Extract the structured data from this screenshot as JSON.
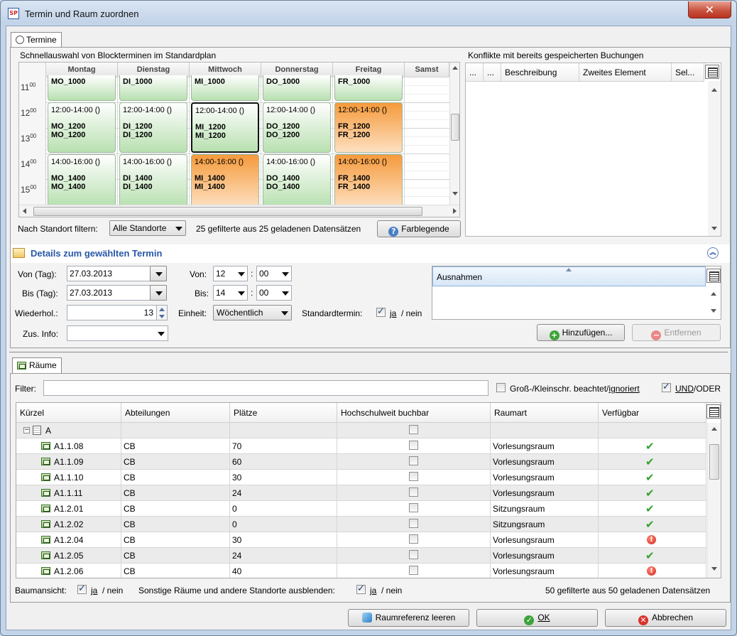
{
  "window": {
    "title": "Termin und Raum zuordnen",
    "close": "✕",
    "app_icon": "SP"
  },
  "termine_tab": {
    "label": "Termine"
  },
  "calendar": {
    "section_title": "Schnellauswahl von Blockterminen im Standardplan",
    "days": [
      "Montag",
      "Dienstag",
      "Mittwoch",
      "Donnerstag",
      "Freitag",
      "Samst"
    ],
    "hours": [
      {
        "h": "11",
        "m": "00"
      },
      {
        "h": "12",
        "m": "00"
      },
      {
        "h": "13",
        "m": "00"
      },
      {
        "h": "14",
        "m": "00"
      },
      {
        "h": "15",
        "m": "00"
      }
    ],
    "row_top": [
      {
        "code": "MO_1000",
        "color": "green"
      },
      {
        "code": "DI_1000",
        "color": "green"
      },
      {
        "code": "MI_1000",
        "color": "green"
      },
      {
        "code": "DO_1000",
        "color": "green"
      },
      {
        "code": "FR_1000",
        "color": "green"
      }
    ],
    "row_mid": [
      {
        "time": "12:00-14:00 ()",
        "code": "MO_1200",
        "color": "green",
        "selected": false
      },
      {
        "time": "12:00-14:00 ()",
        "code": "DI_1200",
        "color": "green",
        "selected": false
      },
      {
        "time": "12:00-14:00 ()",
        "code": "MI_1200",
        "color": "green",
        "selected": true
      },
      {
        "time": "12:00-14:00 ()",
        "code": "DO_1200",
        "color": "green",
        "selected": false
      },
      {
        "time": "12:00-14:00 ()",
        "code": "FR_1200",
        "color": "orange",
        "selected": false
      }
    ],
    "row_bot": [
      {
        "time": "14:00-16:00 ()",
        "code": "MO_1400",
        "color": "green"
      },
      {
        "time": "14:00-16:00 ()",
        "code": "DI_1400",
        "color": "green"
      },
      {
        "time": "14:00-16:00 ()",
        "code": "MI_1400",
        "color": "orange"
      },
      {
        "time": "14:00-16:00 ()",
        "code": "DO_1400",
        "color": "green"
      },
      {
        "time": "14:00-16:00 ()",
        "code": "FR_1400",
        "color": "orange"
      }
    ],
    "filter_label": "Nach Standort filtern:",
    "filter_value": "Alle Standorte",
    "count_text": "25 gefilterte aus 25 geladenen Datensätzen",
    "legend_button": "Farblegende"
  },
  "conflicts": {
    "title": "Konflikte mit bereits gespeicherten Buchungen",
    "columns": [
      "...",
      "...",
      "Beschreibung",
      "Zweites Element",
      "Sel..."
    ]
  },
  "details": {
    "title": "Details zum gewählten Termin",
    "von_tag_label": "Von (Tag):",
    "von_tag_value": "27.03.2013",
    "bis_tag_label": "Bis (Tag):",
    "bis_tag_value": "27.03.2013",
    "wiederhol_label": "Wiederhol.:",
    "wiederhol_value": "13",
    "zus_info_label": "Zus. Info:",
    "zus_info_value": "",
    "von_label": "Von:",
    "von_h": "12",
    "von_m": "00",
    "bis_label": "Bis:",
    "bis_h": "14",
    "bis_m": "00",
    "einheit_label": "Einheit:",
    "einheit_value": "Wöchentlich",
    "standardtermin_label": "Standardtermin:",
    "standardtermin_ja": "ja",
    "standardtermin_sep": "/ nein",
    "ausnahmen_header": "Ausnahmen",
    "add_button": "Hinzufügen...",
    "remove_button": "Entfernen"
  },
  "rooms": {
    "tab_label": "Räume",
    "filter_label": "Filter:",
    "filter_value": "",
    "case_label": "Groß-/Kleinschr. beachtet/",
    "case_ignored": "ignoriert",
    "und_label": "UND",
    "oder_label": "/ODER",
    "columns": [
      "Kürzel",
      "Abteilungen",
      "Plätze",
      "Hochschulweit buchbar",
      "Raumart",
      "Verfügbar"
    ],
    "group": "A",
    "rows": [
      {
        "code": "A1.1.08",
        "dept": "CB",
        "seats": "70",
        "type": "Vorlesungsraum",
        "avail": "ok"
      },
      {
        "code": "A1.1.09",
        "dept": "CB",
        "seats": "60",
        "type": "Vorlesungsraum",
        "avail": "ok"
      },
      {
        "code": "A1.1.10",
        "dept": "CB",
        "seats": "30",
        "type": "Vorlesungsraum",
        "avail": "ok"
      },
      {
        "code": "A1.1.11",
        "dept": "CB",
        "seats": "24",
        "type": "Vorlesungsraum",
        "avail": "ok"
      },
      {
        "code": "A1.2.01",
        "dept": "CB",
        "seats": "0",
        "type": "Sitzungsraum",
        "avail": "ok"
      },
      {
        "code": "A1.2.02",
        "dept": "CB",
        "seats": "0",
        "type": "Sitzungsraum",
        "avail": "ok"
      },
      {
        "code": "A1.2.04",
        "dept": "CB",
        "seats": "30",
        "type": "Vorlesungsraum",
        "avail": "warn"
      },
      {
        "code": "A1.2.05",
        "dept": "CB",
        "seats": "24",
        "type": "Vorlesungsraum",
        "avail": "ok"
      },
      {
        "code": "A1.2.06",
        "dept": "CB",
        "seats": "40",
        "type": "Vorlesungsraum",
        "avail": "warn"
      }
    ],
    "baum_label": "Baumansicht:",
    "baum_ja": "ja",
    "baum_sep": "/ nein",
    "sonstige_label": "Sonstige Räume und andere Standorte ausblenden:",
    "sonstige_ja": "ja",
    "sonstige_sep": "/ nein",
    "count_text": "50 gefilterte aus 50 geladenen Datensätzen"
  },
  "footer": {
    "clear_button": "Raumreferenz leeren",
    "ok_button": "OK",
    "cancel_button": "Abbrechen"
  }
}
